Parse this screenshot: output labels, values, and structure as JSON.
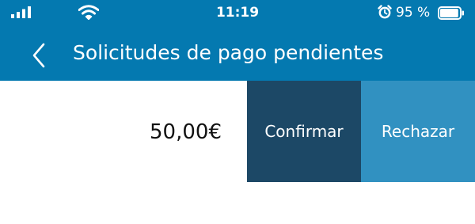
{
  "status_bar": {
    "time": "11:19",
    "battery_percent": "95 %",
    "battery_level": 0.95,
    "icons": [
      "signal-icon",
      "wifi-icon",
      "alarm-icon",
      "battery-icon"
    ]
  },
  "header": {
    "title": "Solicitudes de pago pendientes",
    "back_icon": "chevron-left-icon"
  },
  "requests": [
    {
      "amount": "50,00€",
      "confirm_label": "Confirmar",
      "reject_label": "Rechazar"
    }
  ],
  "colors": {
    "header_bg": "#0479b0",
    "confirm_bg": "#1c4866",
    "reject_bg": "#3191c1",
    "text_light": "#ffffff"
  }
}
